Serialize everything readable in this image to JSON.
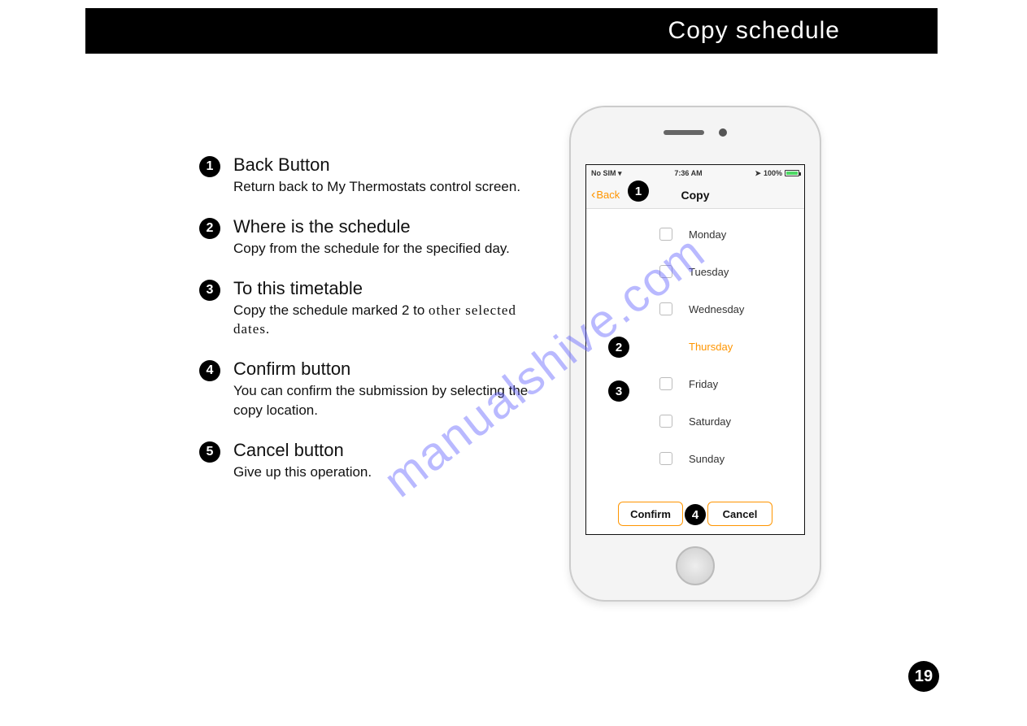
{
  "header": {
    "title": "Copy schedule"
  },
  "instructions": [
    {
      "num": "1",
      "title": "Back Button",
      "desc": "Return back to My Thermostats control screen."
    },
    {
      "num": "2",
      "title": "Where is the schedule",
      "desc": "Copy from the schedule for the specified day."
    },
    {
      "num": "3",
      "title": "To this timetable",
      "desc_a": "Copy the schedule marked 2 to",
      "desc_b": "other selected dates."
    },
    {
      "num": "4",
      "title": "Confirm button",
      "desc": "You can confirm the submission by selecting the copy location."
    },
    {
      "num": "5",
      "title": "Cancel button",
      "desc": "Give up this operation."
    }
  ],
  "phone": {
    "status": {
      "left": "No SIM",
      "time": "7:36 AM",
      "battery": "100%"
    },
    "nav": {
      "back": "Back",
      "title": "Copy"
    },
    "days": [
      {
        "label": "Monday",
        "checkbox": true,
        "source": false
      },
      {
        "label": "Tuesday",
        "checkbox": true,
        "source": false
      },
      {
        "label": "Wednesday",
        "checkbox": true,
        "source": false
      },
      {
        "label": "Thursday",
        "checkbox": false,
        "source": true
      },
      {
        "label": "Friday",
        "checkbox": true,
        "source": false
      },
      {
        "label": "Saturday",
        "checkbox": true,
        "source": false
      },
      {
        "label": "Sunday",
        "checkbox": true,
        "source": false
      }
    ],
    "confirm": "Confirm",
    "cancel": "Cancel"
  },
  "overlays": {
    "m1": "1",
    "m2": "2",
    "m3": "3",
    "m4": "4"
  },
  "page_number": "19",
  "watermark": "manualshive.com"
}
